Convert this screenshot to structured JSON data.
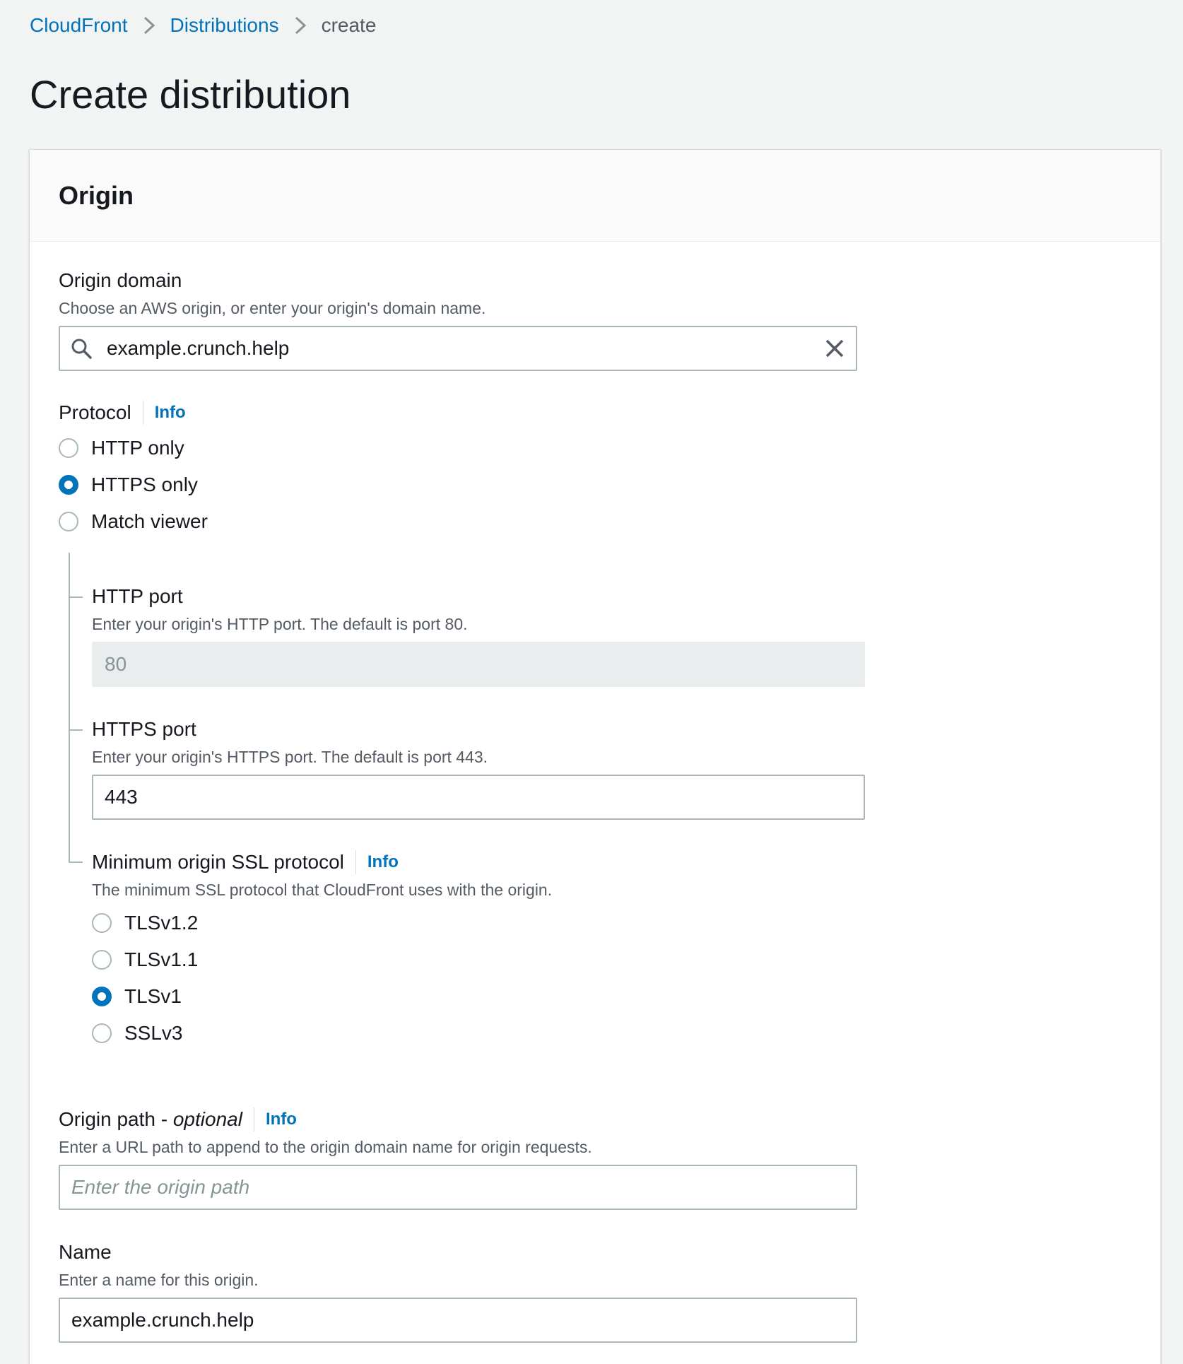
{
  "breadcrumb": {
    "items": [
      "CloudFront",
      "Distributions"
    ],
    "current": "create"
  },
  "page": {
    "title": "Create distribution"
  },
  "origin_panel": {
    "title": "Origin",
    "origin_domain": {
      "label": "Origin domain",
      "description": "Choose an AWS origin, or enter your origin's domain name.",
      "value": "example.crunch.help"
    },
    "protocol": {
      "label": "Protocol",
      "info": "Info",
      "options": [
        "HTTP only",
        "HTTPS only",
        "Match viewer"
      ],
      "selected": "HTTPS only"
    },
    "http_port": {
      "label": "HTTP port",
      "description": "Enter your origin's HTTP port. The default is port 80.",
      "value": "80"
    },
    "https_port": {
      "label": "HTTPS port",
      "description": "Enter your origin's HTTPS port. The default is port 443.",
      "value": "443"
    },
    "min_ssl": {
      "label": "Minimum origin SSL protocol",
      "info": "Info",
      "description": "The minimum SSL protocol that CloudFront uses with the origin.",
      "options": [
        "TLSv1.2",
        "TLSv1.1",
        "TLSv1",
        "SSLv3"
      ],
      "selected": "TLSv1"
    },
    "origin_path": {
      "label": "Origin path - ",
      "label_optional": "optional",
      "info": "Info",
      "description": "Enter a URL path to append to the origin domain name for origin requests.",
      "placeholder": "Enter the origin path"
    },
    "name": {
      "label": "Name",
      "description": "Enter a name for this origin.",
      "value": "example.crunch.help"
    }
  },
  "icons": {
    "search": "search-icon",
    "clear": "close-icon",
    "breadcrumb_separator": "chevron-right-icon"
  }
}
